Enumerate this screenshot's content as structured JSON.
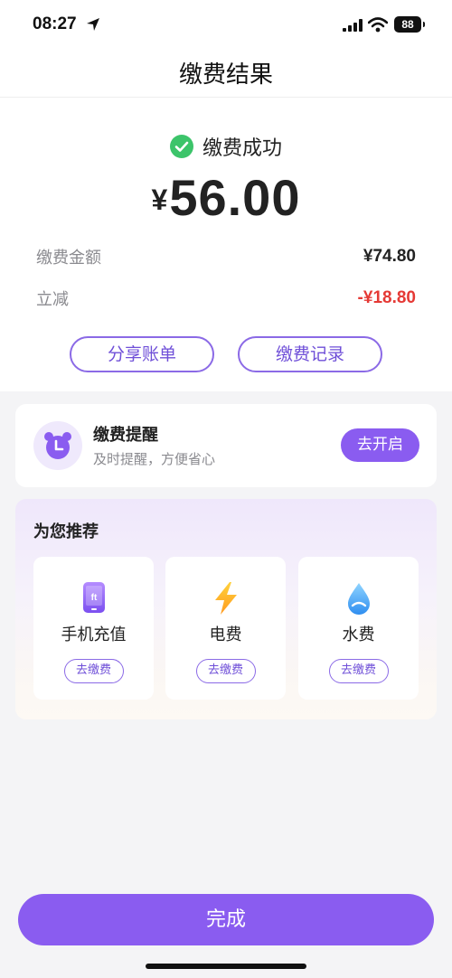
{
  "status_bar": {
    "time": "08:27",
    "battery": "88"
  },
  "header": {
    "title": "缴费结果"
  },
  "result": {
    "status_text": "缴费成功",
    "currency": "¥",
    "amount": "56.00",
    "rows": [
      {
        "label": "缴费金额",
        "value": "¥74.80"
      },
      {
        "label": "立减",
        "value": "-¥18.80"
      }
    ],
    "share_label": "分享账单",
    "records_label": "缴费记录"
  },
  "reminder": {
    "title": "缴费提醒",
    "subtitle": "及时提醒，方便省心",
    "button": "去开启"
  },
  "recommendations": {
    "title": "为您推荐",
    "items": [
      {
        "name": "手机充值",
        "button": "去缴费",
        "icon": "phone-icon"
      },
      {
        "name": "电费",
        "button": "去缴费",
        "icon": "lightning-icon"
      },
      {
        "name": "水费",
        "button": "去缴费",
        "icon": "water-drop-icon"
      }
    ]
  },
  "done_label": "完成",
  "colors": {
    "accent": "#8a5cf0",
    "success": "#3cc46a",
    "discount": "#e53935"
  }
}
